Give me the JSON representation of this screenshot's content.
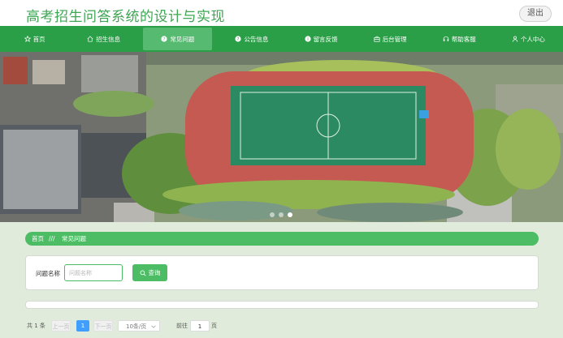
{
  "header": {
    "title": "高考招生问答系统的设计与实现",
    "logout_label": "退出"
  },
  "nav": [
    {
      "label": "首页",
      "icon": "star-icon"
    },
    {
      "label": "招生信息",
      "icon": "home-icon"
    },
    {
      "label": "常见问题",
      "icon": "question-icon",
      "active": true
    },
    {
      "label": "公告信息",
      "icon": "info-icon"
    },
    {
      "label": "留言反馈",
      "icon": "message-icon"
    },
    {
      "label": "后台管理",
      "icon": "briefcase-icon"
    },
    {
      "label": "帮助客服",
      "icon": "headset-icon"
    },
    {
      "label": "个人中心",
      "icon": "user-icon"
    }
  ],
  "carousel": {
    "slides": 3,
    "active": 3
  },
  "breadcrumb": {
    "home": "首页",
    "separator": "///",
    "current": "常见问题"
  },
  "search": {
    "label": "问题名称",
    "placeholder": "问题名称",
    "button_label": "查询"
  },
  "pagination": {
    "total_text": "共 1 条",
    "prev_label": "上一页",
    "page": "1",
    "next_label": "下一页",
    "page_size": "10条/页",
    "goto_label": "前往",
    "goto_value": "1",
    "page_suffix": "页"
  },
  "colors": {
    "primary": "#2a9f47",
    "accent": "#4dbd65",
    "active_nav": "#56bb70",
    "title": "#3ea653",
    "page_button": "#409eff"
  }
}
